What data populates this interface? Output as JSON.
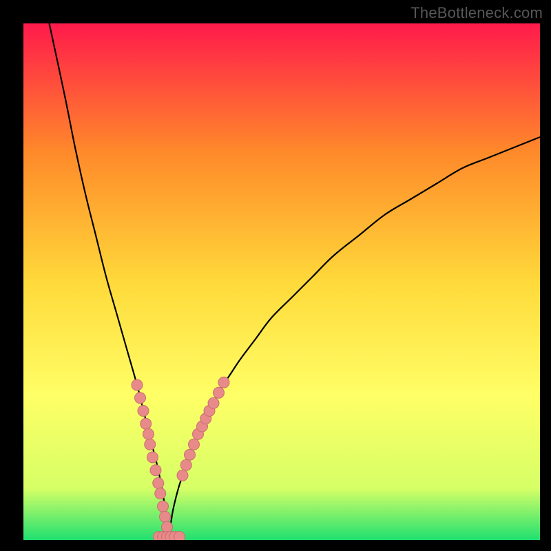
{
  "watermark": "TheBottleneck.com",
  "colors": {
    "frame": "#000000",
    "gradient_top": "#ff1a4b",
    "gradient_mid1": "#ff8a2a",
    "gradient_mid2": "#ffd93a",
    "gradient_mid3": "#ffff66",
    "gradient_mid4": "#d6ff66",
    "gradient_bottom": "#20e070",
    "curve": "#000000",
    "marker_fill": "#e88a8a",
    "marker_stroke": "#c96f6f"
  },
  "chart_data": {
    "type": "line",
    "title": "",
    "xlabel": "",
    "ylabel": "",
    "xlim": [
      0,
      100
    ],
    "ylim": [
      0,
      100
    ],
    "grid": false,
    "notch_x": 28,
    "curve": {
      "comment": "y approximates bottleneck percentage; cusp at notch_x=28, y=0",
      "x": [
        5,
        8,
        10,
        12,
        14,
        16,
        18,
        20,
        22,
        23,
        24,
        25,
        26,
        27,
        27.5,
        28,
        28.5,
        29,
        30,
        31,
        32,
        33,
        34,
        35,
        36,
        38,
        40,
        42,
        45,
        48,
        52,
        56,
        60,
        65,
        70,
        75,
        80,
        85,
        90,
        95,
        100
      ],
      "y": [
        100,
        86,
        76,
        67,
        59,
        51,
        44,
        37,
        30,
        26,
        22,
        18,
        14,
        9,
        5,
        0,
        3,
        6,
        10,
        13,
        16,
        18,
        21,
        23,
        25,
        29,
        32,
        35,
        39,
        43,
        47,
        51,
        55,
        59,
        63,
        66,
        69,
        72,
        74,
        76,
        78
      ]
    },
    "series": [
      {
        "name": "left-branch-markers",
        "x": [
          22.0,
          22.6,
          23.2,
          23.7,
          24.2,
          24.5,
          25.0,
          25.6,
          26.1,
          26.5,
          27.0,
          27.4,
          27.8
        ],
        "y": [
          30,
          27.5,
          25.0,
          22.5,
          20.5,
          18.5,
          16.0,
          13.5,
          11.0,
          9.0,
          6.5,
          4.5,
          2.5
        ]
      },
      {
        "name": "right-branch-markers",
        "x": [
          30.8,
          31.5,
          32.2,
          33.0,
          33.8,
          34.6,
          35.3,
          36.0,
          36.8,
          37.8,
          38.8
        ],
        "y": [
          12.5,
          14.5,
          16.5,
          18.5,
          20.5,
          22.0,
          23.5,
          25.0,
          26.5,
          28.5,
          30.5
        ]
      },
      {
        "name": "bottom-markers",
        "x": [
          26.2,
          27.0,
          27.8,
          28.5,
          29.3,
          30.2
        ],
        "y": [
          0.6,
          0.6,
          0.6,
          0.6,
          0.6,
          0.6
        ]
      }
    ]
  }
}
